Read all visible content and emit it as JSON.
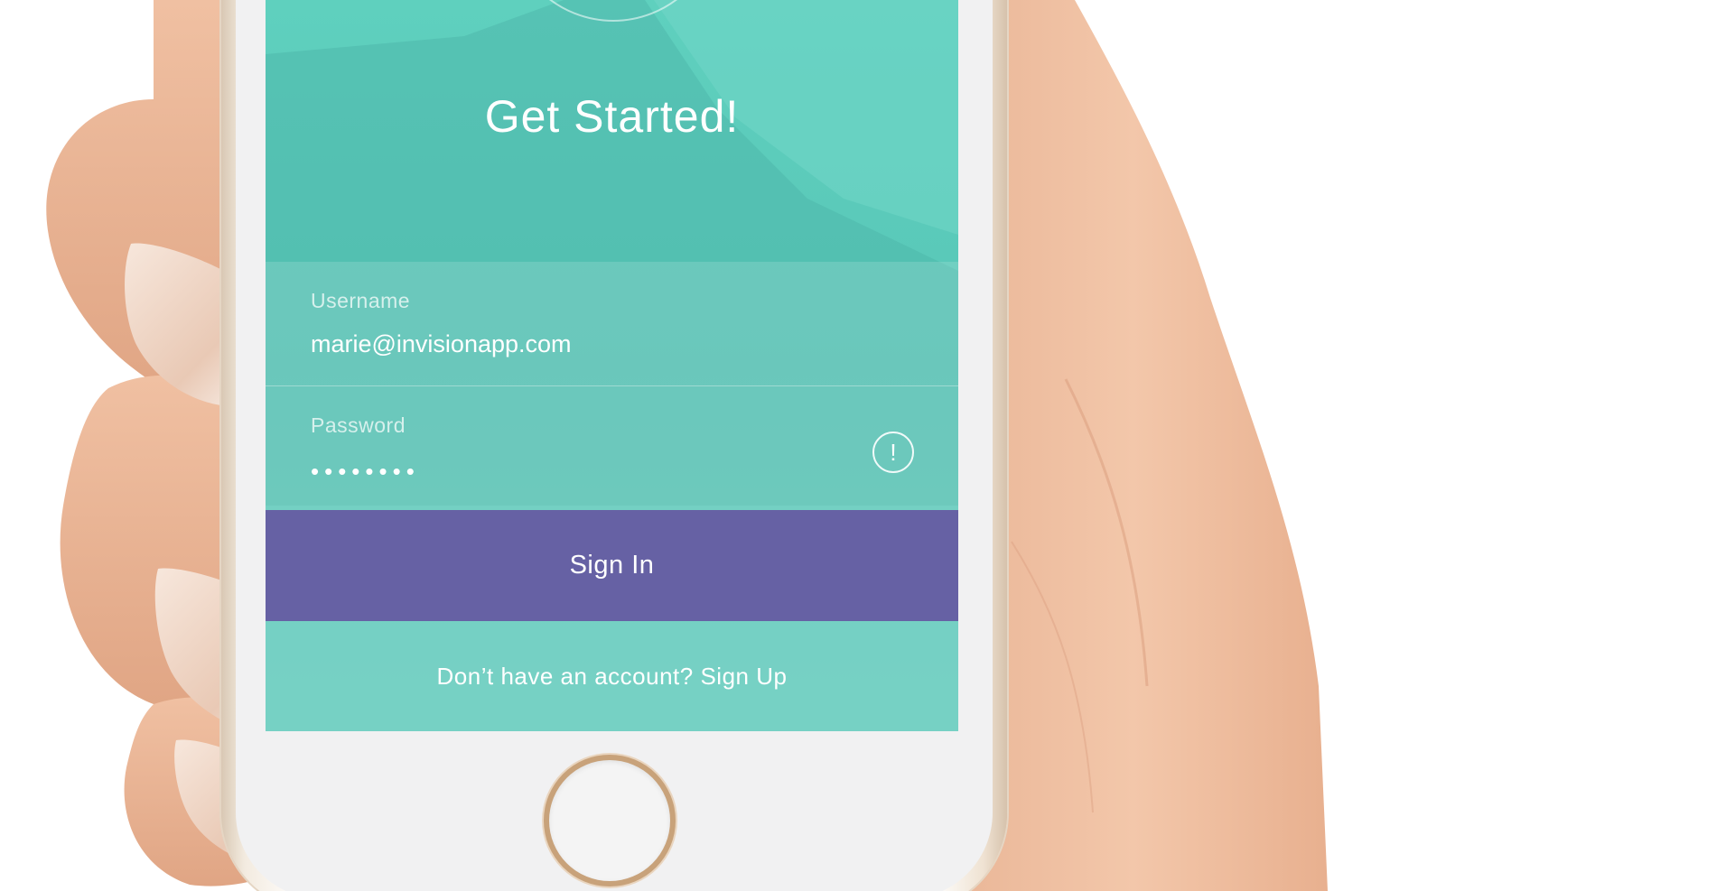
{
  "screen": {
    "title": "Get Started!",
    "username": {
      "label": "Username",
      "value": "marie@invisionapp.com"
    },
    "password": {
      "label": "Password",
      "masked_value": "••••••••",
      "warning_icon": "exclamation-circle-icon"
    },
    "signin_label": "Sign In",
    "signup_text": "Don’t have an account? Sign Up"
  },
  "colors": {
    "teal_background": "#5fd0be",
    "signin_button": "#6661a4",
    "text": "#ffffff",
    "phone_frame": "#f1f1f2"
  }
}
